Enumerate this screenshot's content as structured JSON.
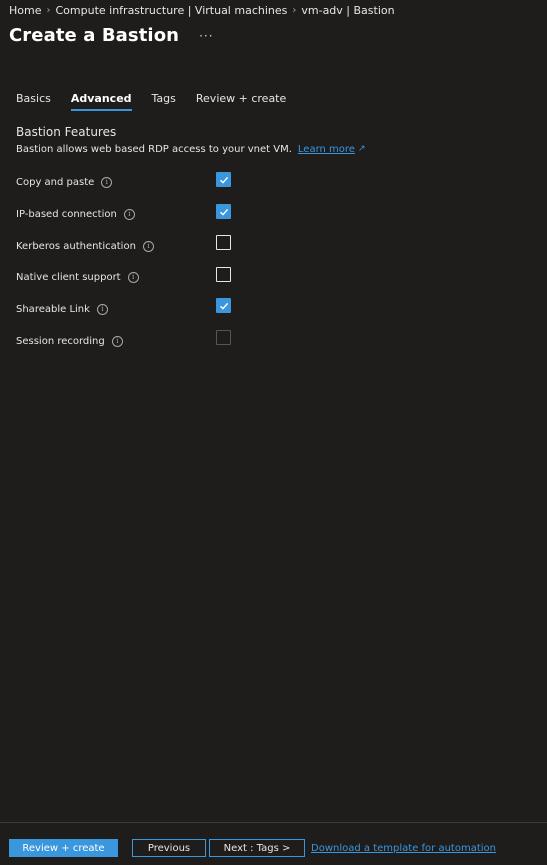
{
  "breadcrumb": {
    "items": [
      "Home",
      "Compute infrastructure | Virtual machines",
      "vm-adv | Bastion"
    ],
    "separator_icon": "chevron-right-icon"
  },
  "header": {
    "title": "Create a Bastion",
    "more_label": "···"
  },
  "tabs": [
    {
      "label": "Basics",
      "active": false
    },
    {
      "label": "Advanced",
      "active": true
    },
    {
      "label": "Tags",
      "active": false
    },
    {
      "label": "Review + create",
      "active": false
    }
  ],
  "section": {
    "title": "Bastion Features",
    "description": "Bastion allows web based RDP access to your vnet VM.",
    "learn_more": "Learn more"
  },
  "features": [
    {
      "label": "Copy and paste",
      "checked": true,
      "disabled": false
    },
    {
      "label": "IP-based connection",
      "checked": true,
      "disabled": false
    },
    {
      "label": "Kerberos authentication",
      "checked": false,
      "disabled": false
    },
    {
      "label": "Native client support",
      "checked": false,
      "disabled": false
    },
    {
      "label": "Shareable Link",
      "checked": true,
      "disabled": false
    },
    {
      "label": "Session recording",
      "checked": false,
      "disabled": true
    }
  ],
  "footer": {
    "review_create": "Review + create",
    "previous": "Previous",
    "next": "Next : Tags >",
    "download_template": "Download a template for automation"
  },
  "colors": {
    "background": "#1f1d1c",
    "accent": "#3a96dd",
    "text": "#e6e6e6"
  }
}
